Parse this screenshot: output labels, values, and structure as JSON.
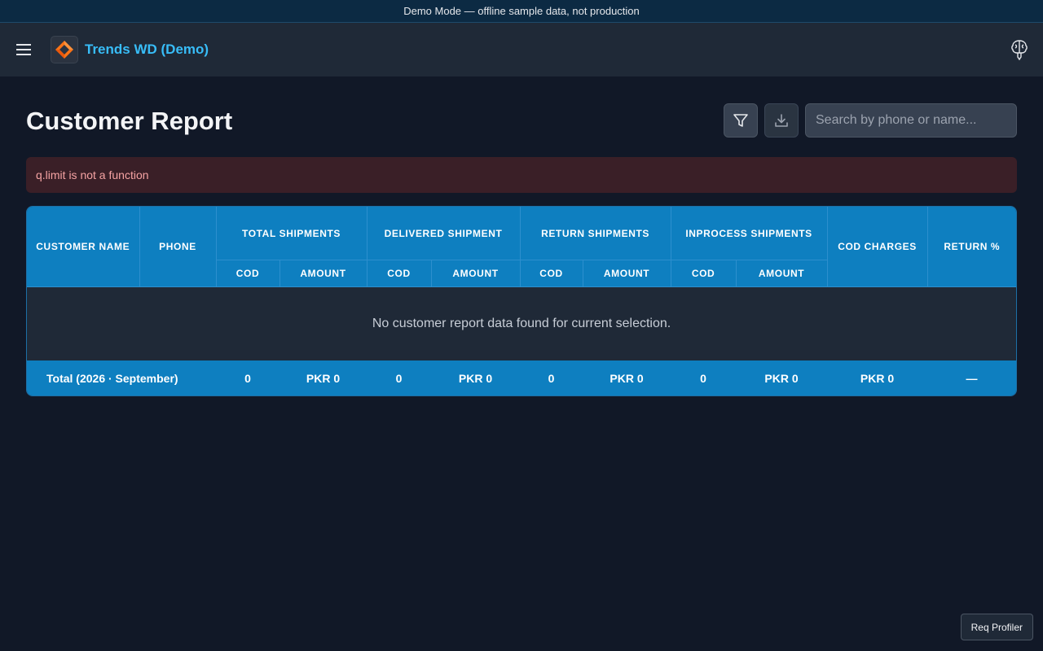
{
  "banner": {
    "text": "Demo Mode — offline sample data, not production"
  },
  "header": {
    "title": "Trends WD (Demo)",
    "icons": {
      "menu": "hamburger-menu-icon",
      "logo": "app-logo-icon",
      "profiler": "brain-icon"
    }
  },
  "page": {
    "title": "Customer Report"
  },
  "toolbar": {
    "filter_icon": "filter-icon",
    "download_icon": "download-icon",
    "search_placeholder": "Search by phone or name...",
    "search_value": ""
  },
  "error": {
    "message": "q.limit is not a function"
  },
  "table": {
    "headers": {
      "customer_name": "Customer Name",
      "phone": "Phone",
      "total_shipments": "Total Shipments",
      "delivered_shipment": "Delivered Shipment",
      "return_shipments": "Return Shipments",
      "inprocess_shipments": "Inprocess Shipments",
      "cod_charges": "COD Charges",
      "return_pct": "Return %",
      "sub_cod": "COD",
      "sub_amount": "Amount"
    },
    "empty_message": "No customer report data found for current selection.",
    "total_row": {
      "label": "Total (2026 · September)",
      "total_cod": "0",
      "total_amount": "PKR 0",
      "delivered_cod": "0",
      "delivered_amount": "PKR 0",
      "return_cod": "0",
      "return_amount": "PKR 0",
      "inprocess_cod": "0",
      "inprocess_amount": "PKR 0",
      "cod_charges": "PKR 0",
      "return_pct": "—"
    }
  },
  "footer": {
    "profiler_label": "Req Profiler"
  },
  "colors": {
    "background": "#111827",
    "accent": "#38bdf8",
    "table_header": "#0e7fc0",
    "error_bg": "#3a1f27",
    "error_text": "#f5a3a3"
  }
}
